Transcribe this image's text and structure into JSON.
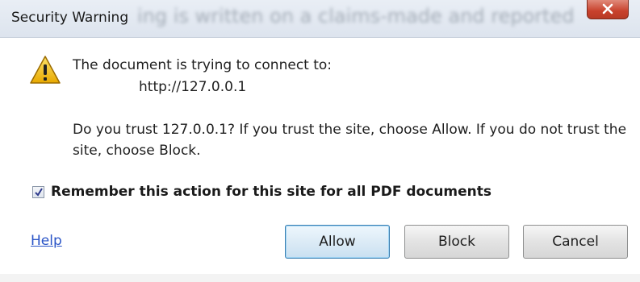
{
  "window": {
    "title": "Security Warning",
    "background_text": "ing is written on a claims-made and reported"
  },
  "message": {
    "line1": "The document is trying to connect to:",
    "url": "http://127.0.0.1",
    "trust_text": "Do you trust 127.0.0.1? If you trust the site, choose Allow. If you do not trust the site, choose Block."
  },
  "remember": {
    "label": "Remember this action for this site for all PDF documents",
    "checked": true
  },
  "footer": {
    "help_label": "Help",
    "allow_label": "Allow",
    "block_label": "Block",
    "cancel_label": "Cancel"
  },
  "colors": {
    "link": "#2b55c7",
    "close_button": "#c8412c",
    "warning_icon": "#f2c200"
  },
  "icons": {
    "warning": "warning-icon",
    "close": "close-icon",
    "check": "check-icon"
  }
}
